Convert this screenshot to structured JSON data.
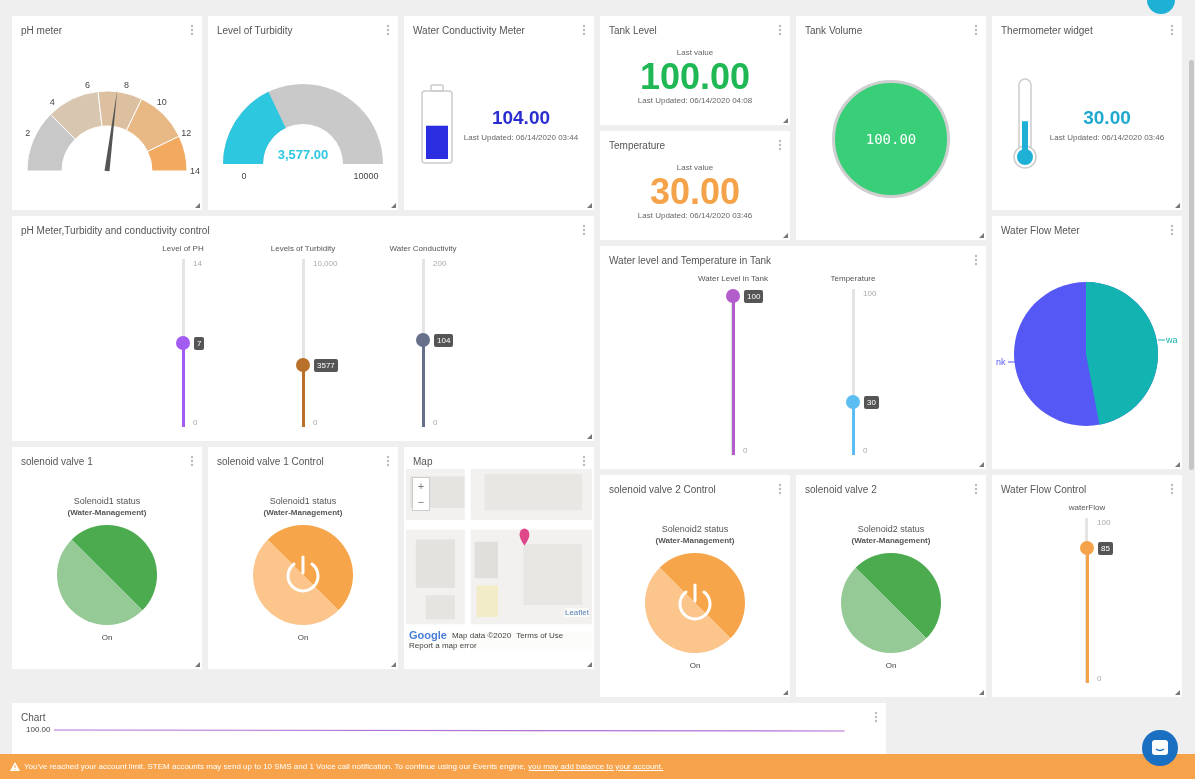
{
  "cards": [
    {
      "kind": "ph_gauge",
      "title": "pH meter",
      "ticks": [
        "2",
        "4",
        "6",
        "8",
        "10",
        "12",
        "14"
      ],
      "level": 0.54
    },
    {
      "kind": "half_gauge",
      "title": "Level of Turbidity",
      "value": "3,577.00",
      "min": "0",
      "max": "10000",
      "level": 0.3577
    },
    {
      "kind": "battery",
      "title": "Water Conductivity Meter",
      "value": "104.00",
      "updated": "Last Updated: 06/14/2020 03:44",
      "level": 0.52
    },
    {
      "kind": "value",
      "title": "Tank Level",
      "caption": "Last value",
      "value": "100.00",
      "color": "#1fb855",
      "updated": "Last Updated: 06/14/2020 04:08"
    },
    {
      "kind": "volume",
      "title": "Tank Volume",
      "value": "100.00"
    },
    {
      "kind": "thermometer",
      "title": "Thermometer widget",
      "value": "30.00",
      "updated": "Last Updated: 06/14/2020 03:46",
      "level": 0.45
    },
    {
      "kind": "value",
      "title": "Temperature",
      "caption": "Last value",
      "value": "30.00",
      "color": "#f5a34a",
      "updated": "Last Updated: 06/14/2020 03:46"
    },
    {
      "kind": "sliders",
      "title": "pH Meter,Turbidity and conductivity control",
      "sliders": [
        {
          "label": "Level of PH",
          "max": "14",
          "min": "0",
          "value": "7",
          "level": 0.5,
          "color": "#a35cf2"
        },
        {
          "label": "Levels of Turbidity",
          "max": "10,000",
          "min": "0",
          "value": "3577",
          "level": 0.3577,
          "color": "#b8702a"
        },
        {
          "label": "Water Conductivity",
          "max": "200",
          "min": "0",
          "value": "104",
          "level": 0.52,
          "color": "#66708a"
        }
      ]
    },
    {
      "kind": "pie",
      "title": "Water Flow Meter",
      "labels": [
        "nk",
        "wa"
      ]
    },
    {
      "kind": "sliders",
      "title": "Water level and Temperature in Tank",
      "sliders": [
        {
          "label": "Water Level in Tank",
          "min": "0",
          "value": "100",
          "level": 1,
          "color": "#b35ccc"
        },
        {
          "label": "Temperature",
          "max": "100",
          "min": "0",
          "value": "30",
          "level": 0.3,
          "color": "#5cbdf2"
        }
      ]
    },
    {
      "kind": "valve",
      "title": "solenoid valve 1",
      "label": "Solenoid1 status",
      "device": "(Water-Management)",
      "state": "On",
      "on": true,
      "switch": false
    },
    {
      "kind": "valve",
      "title": "solenoid valve 1 Control",
      "label": "Solenoid1 status",
      "device": "(Water-Management)",
      "state": "On",
      "on": true,
      "switch": true
    },
    {
      "kind": "map",
      "title": "Map",
      "zoom_in": "+",
      "zoom_out": "−",
      "logo": "Google",
      "attribution": [
        "Map data ©2020",
        "Terms of Use",
        "Report a map error"
      ],
      "leaflet": "Leaflet"
    },
    {
      "kind": "valve",
      "title": "solenoid valve 2 Control",
      "label": "Solenoid2 status",
      "device": "(Water-Management)",
      "state": "On",
      "on": true,
      "switch": true
    },
    {
      "kind": "valve",
      "title": "solenoid valve 2",
      "label": "Solenoid2 status",
      "device": "(Water-Management)",
      "state": "On",
      "on": true,
      "switch": false
    },
    {
      "kind": "sliders",
      "title": "Water Flow Control",
      "sliders": [
        {
          "label": "waterFlow",
          "max": "100",
          "min": "0",
          "value": "85",
          "level": 0.85,
          "color": "#f5a34a"
        }
      ]
    },
    {
      "kind": "chart",
      "title": "Chart",
      "y_tick": "100.00"
    }
  ],
  "banner": {
    "text": "You've reached your account limit. STEM accounts may send up to 10 SMS and 1 Voice call notification. To continue using our Events engine,",
    "link": "you may add balance to your account."
  }
}
